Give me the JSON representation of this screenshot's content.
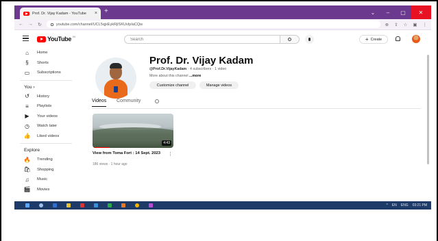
{
  "browser": {
    "tab_title": "Prof. Dr. Vijay Kadam - YouTube",
    "tab_close": "×",
    "new_tab": "+",
    "url": "youtube.com/channel/UCL5qjxEykRjISKUvIpIaCQw",
    "window_controls": [
      "⌄",
      "–",
      "▢",
      "✕"
    ],
    "nav_icons": [
      "←",
      "→",
      "↻"
    ],
    "toolbar_icons": [
      "⊕",
      "⇪",
      "☆",
      "▣",
      "⋮"
    ]
  },
  "header": {
    "logo_text": "YouTube",
    "logo_region": "IN",
    "search_placeholder": "Search",
    "create_label": "Create",
    "create_plus": "+"
  },
  "sidebar": {
    "top_items": [
      {
        "icon": "⌂",
        "label": "Home"
      },
      {
        "icon": "§",
        "label": "Shorts"
      },
      {
        "icon": "▭",
        "label": "Subscriptions"
      }
    ],
    "you_heading": "You  ›",
    "you_items": [
      {
        "icon": "↺",
        "label": "History"
      },
      {
        "icon": "≡",
        "label": "Playlists"
      },
      {
        "icon": "▶",
        "label": "Your videos"
      },
      {
        "icon": "◷",
        "label": "Watch later"
      },
      {
        "icon": "👍",
        "label": "Liked videos"
      }
    ],
    "explore_heading": "Explore",
    "explore_items": [
      {
        "icon": "🔥",
        "label": "Trending"
      },
      {
        "icon": "🛍",
        "label": "Shopping"
      },
      {
        "icon": "♫",
        "label": "Music"
      },
      {
        "icon": "🎬",
        "label": "Movies"
      }
    ]
  },
  "channel": {
    "name": "Prof. Dr. Vijay Kadam",
    "handle": "@Prof.Dr.VijayKadam",
    "stats": " · 4 subscribers · 1 video",
    "about": "More about this channel ",
    "about_more": "...more",
    "customize_label": "Customize channel",
    "manage_label": "Manage videos"
  },
  "tabs": {
    "videos": "Videos",
    "community": "Community"
  },
  "video": {
    "title": "View from Toma Fort : 14 Sept. 2023",
    "menu": "⋮",
    "meta": "186 views · 1 hour ago",
    "duration": "4:43",
    "watched_fraction": 0.2
  },
  "taskbar": {
    "tray": [
      "^",
      "EN",
      "ENG",
      "03:21 PM"
    ]
  },
  "colors": {
    "tabstrip": "#6b3a8e",
    "youtube_red": "#ff0000",
    "taskbar": "#1e3a68"
  }
}
